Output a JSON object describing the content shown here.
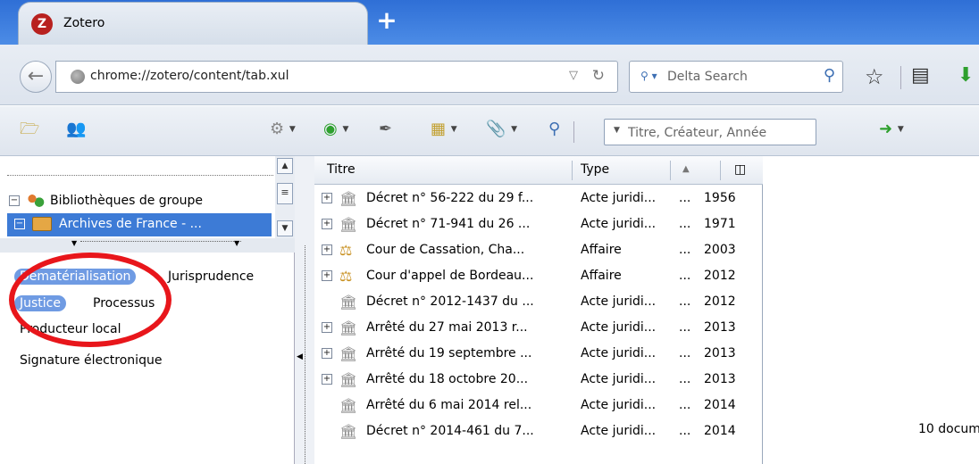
{
  "browser": {
    "tab": {
      "icon": "Z",
      "title": "Zotero"
    },
    "new_tab": "+",
    "url": "chrome://zotero/content/tab.xul",
    "search": {
      "placeholder": "Delta Search",
      "engine_icon": "search-icon"
    }
  },
  "zotero_toolbar": {
    "quick_search_placeholder": "Titre, Créateur, Année"
  },
  "collections": {
    "items": [
      {
        "label": "Bibliothèques de groupe",
        "expanded": true,
        "selected": false
      },
      {
        "label": "Archives de France - ...",
        "expanded": true,
        "selected": true
      }
    ]
  },
  "tags": [
    {
      "label": "Dématérialisation",
      "selected": true
    },
    {
      "label": "Jurisprudence",
      "selected": false
    },
    {
      "label": "Justice",
      "selected": true
    },
    {
      "label": "Processus",
      "selected": false
    },
    {
      "label": "Producteur local",
      "selected": false
    },
    {
      "label": "Signature électronique",
      "selected": false
    }
  ],
  "items": {
    "columns": {
      "title": "Titre",
      "type": "Type"
    },
    "rows": [
      {
        "title": "Décret n° 56-222 du 29 f...",
        "type": "Acte juridi...",
        "dots": "...",
        "year": "1956",
        "expandable": true,
        "icon": "statute-icon"
      },
      {
        "title": "Décret n° 71-941 du 26 ...",
        "type": "Acte juridi...",
        "dots": "...",
        "year": "1971",
        "expandable": true,
        "icon": "statute-icon"
      },
      {
        "title": "Cour de Cassation, Cha...",
        "type": "Affaire",
        "dots": "...",
        "year": "2003",
        "expandable": true,
        "icon": "case-icon"
      },
      {
        "title": "Cour d'appel de Bordeau...",
        "type": "Affaire",
        "dots": "...",
        "year": "2012",
        "expandable": true,
        "icon": "case-icon"
      },
      {
        "title": "Décret n° 2012-1437 du ...",
        "type": "Acte juridi...",
        "dots": "...",
        "year": "2012",
        "expandable": false,
        "icon": "statute-icon"
      },
      {
        "title": "Arrêté du 27 mai 2013  r...",
        "type": "Acte juridi...",
        "dots": "...",
        "year": "2013",
        "expandable": true,
        "icon": "statute-icon"
      },
      {
        "title": "Arrêté du 19 septembre ...",
        "type": "Acte juridi...",
        "dots": "...",
        "year": "2013",
        "expandable": true,
        "icon": "statute-icon"
      },
      {
        "title": "Arrêté du 18 octobre 20...",
        "type": "Acte juridi...",
        "dots": "...",
        "year": "2013",
        "expandable": true,
        "icon": "statute-icon"
      },
      {
        "title": "Arrêté du 6 mai 2014 rel...",
        "type": "Acte juridi...",
        "dots": "...",
        "year": "2014",
        "expandable": false,
        "icon": "statute-icon"
      },
      {
        "title": "Décret n° 2014-461 du 7...",
        "type": "Acte juridi...",
        "dots": "...",
        "year": "2014",
        "expandable": false,
        "icon": "statute-icon"
      }
    ]
  },
  "right_pane": {
    "count_text": "10 docum"
  },
  "colors": {
    "accent": "#3d7bd6",
    "tag_selected": "#6f9be3",
    "annotation": "#e8161b",
    "tabstrip": "#2f6fd6"
  }
}
